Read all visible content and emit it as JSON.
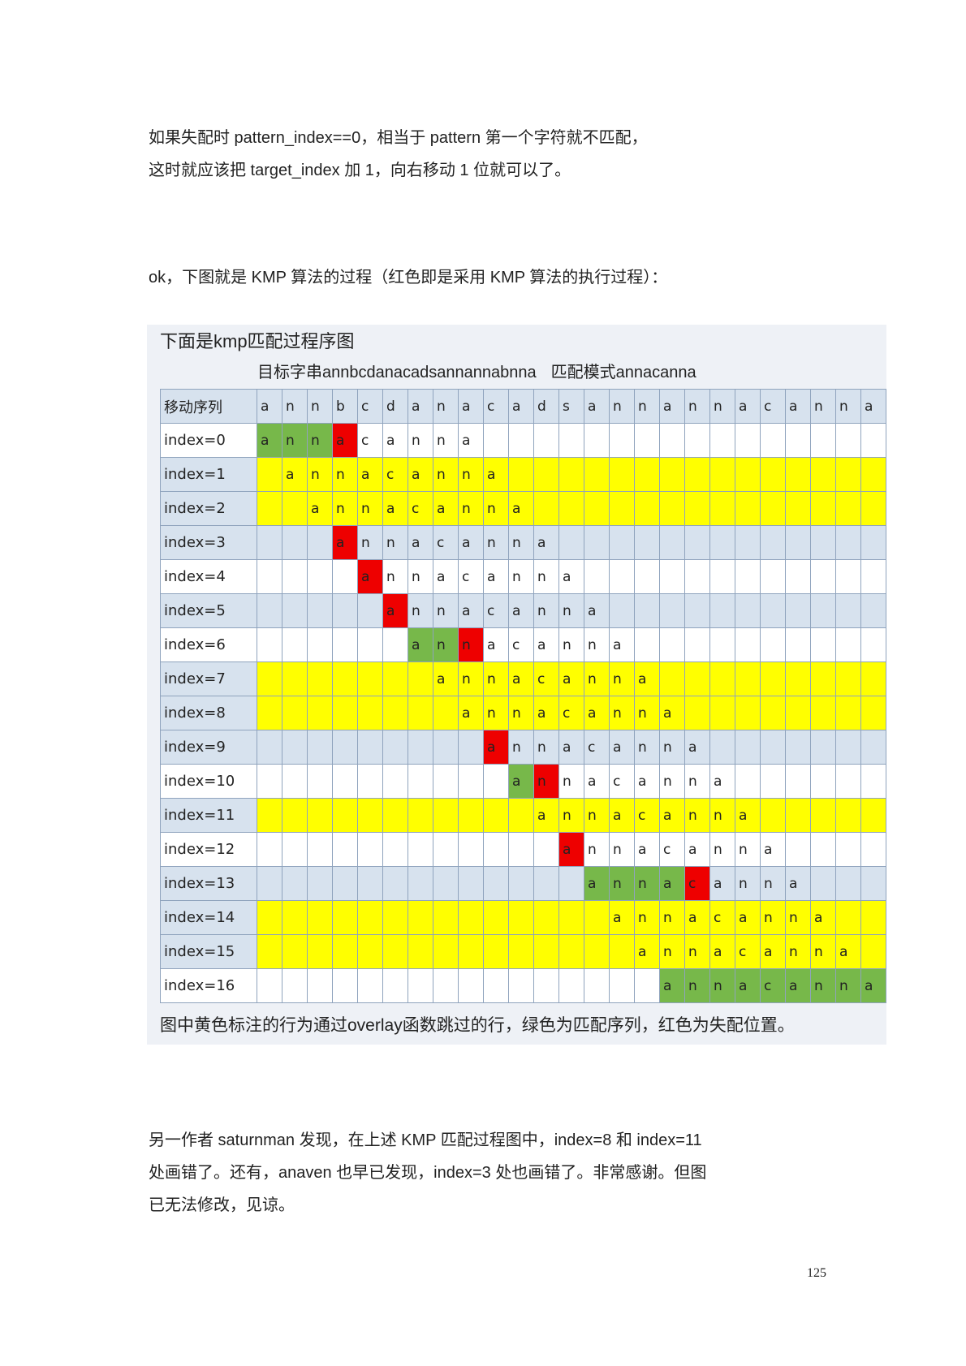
{
  "para1": {
    "line1": " 如果失配时 pattern_index==0，相当于 pattern 第一个字符就不匹配，",
    "line2": "这时就应该把 target_index 加 1，向右移动 1 位就可以了。"
  },
  "para2": "ok，下图就是 KMP 算法的过程（红色即是采用 KMP 算法的执行过程）：",
  "figure": {
    "title": "下面是kmp匹配过程序图",
    "target_label": "目标字串annbcdanacadsannannabnna",
    "pattern_label": "匹配模式annacanna",
    "note": "图中黄色标注的行为通过overlay函数跳过的行，绿色为匹配序列，红色为失配位置。",
    "colors": {
      "yellow": "#ffff00",
      "green": "#77b84a",
      "red": "#ee0000",
      "blue": "#d7e2ee"
    },
    "table": {
      "header_label": "移动序列",
      "header": [
        "a",
        "n",
        "n",
        "b",
        "c",
        "d",
        "a",
        "n",
        "a",
        "c",
        "a",
        "d",
        "s",
        "a",
        "n",
        "n",
        "a",
        "n",
        "n",
        "a",
        "c",
        "a",
        "n",
        "n",
        "a"
      ],
      "pattern": "annacanna",
      "rows": [
        {
          "label": "index=0",
          "offset": 0,
          "style": "white",
          "green": 3,
          "red": 3
        },
        {
          "label": "index=1",
          "offset": 1,
          "style": "yellow",
          "green": 0,
          "red": -1
        },
        {
          "label": "index=2",
          "offset": 2,
          "style": "yellow",
          "green": 0,
          "red": -1
        },
        {
          "label": "index=3",
          "offset": 3,
          "style": "blue",
          "green": 0,
          "red": 0
        },
        {
          "label": "index=4",
          "offset": 4,
          "style": "white",
          "green": 0,
          "red": 0
        },
        {
          "label": "index=5",
          "offset": 5,
          "style": "blue",
          "green": 0,
          "red": 0
        },
        {
          "label": "index=6",
          "offset": 6,
          "style": "white",
          "green": 2,
          "red": 2
        },
        {
          "label": "index=7",
          "offset": 7,
          "style": "yellow",
          "green": 0,
          "red": -1
        },
        {
          "label": "index=8",
          "offset": 8,
          "style": "yellow",
          "green": 0,
          "red": -1
        },
        {
          "label": "index=9",
          "offset": 9,
          "style": "blue",
          "green": 0,
          "red": 0
        },
        {
          "label": "index=10",
          "offset": 10,
          "style": "white",
          "green": 1,
          "red": 1
        },
        {
          "label": "index=11",
          "offset": 11,
          "style": "yellow",
          "green": 0,
          "red": -1
        },
        {
          "label": "index=12",
          "offset": 12,
          "style": "white",
          "green": 0,
          "red": 0
        },
        {
          "label": "index=13",
          "offset": 13,
          "style": "blue",
          "green": 4,
          "red": 4
        },
        {
          "label": "index=14",
          "offset": 14,
          "style": "yellow",
          "green": 0,
          "red": -1
        },
        {
          "label": "index=15",
          "offset": 15,
          "style": "yellow",
          "green": 0,
          "red": -1
        },
        {
          "label": "index=16",
          "offset": 16,
          "style": "white",
          "green": 9,
          "red": -1
        }
      ]
    }
  },
  "para3": {
    "line1": "另一作者 saturnman 发现，在上述 KMP 匹配过程图中，index=8 和 index=11",
    "line2": "处画错了。还有，anaven 也早已发现，index=3 处也画错了。非常感谢。但图",
    "line3": "已无法修改，见谅。"
  },
  "page_number": "125"
}
